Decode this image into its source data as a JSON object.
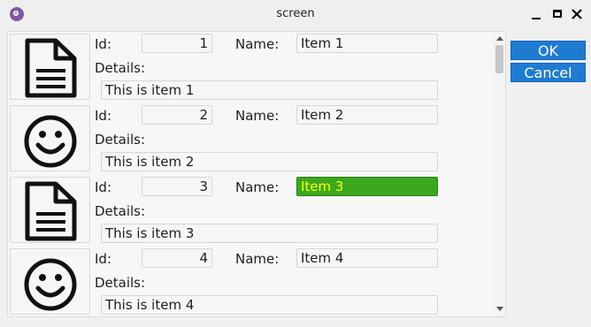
{
  "window": {
    "title": "screen"
  },
  "labels": {
    "id": "Id:",
    "name": "Name:",
    "details": "Details:"
  },
  "items": [
    {
      "icon": "document-icon",
      "id": "1",
      "name": "Item 1",
      "details": "This is item 1"
    },
    {
      "icon": "smiley-icon",
      "id": "2",
      "name": "Item 2",
      "details": "This is item 2"
    },
    {
      "icon": "document-icon",
      "id": "3",
      "name": "Item 3",
      "details": "This is item 3",
      "highlighted": true
    },
    {
      "icon": "smiley-icon",
      "id": "4",
      "name": "Item 4",
      "details": "This is item 4"
    }
  ],
  "buttons": {
    "ok": "OK",
    "cancel": "Cancel"
  },
  "colors": {
    "accent": "#1f7bd2",
    "highlight_bg": "#3aa81f",
    "highlight_text": "#ffff00"
  }
}
